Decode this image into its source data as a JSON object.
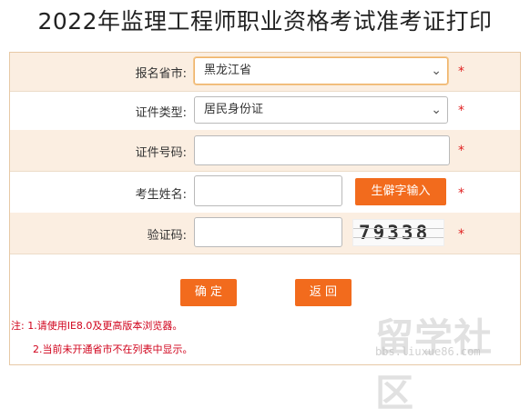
{
  "page": {
    "title": "2022年监理工程师职业资格考试准考证打印"
  },
  "form": {
    "province": {
      "label": "报名省市:",
      "value": "黑龙江省"
    },
    "id_type": {
      "label": "证件类型:",
      "value": "居民身份证"
    },
    "id_number": {
      "label": "证件号码:",
      "value": ""
    },
    "name": {
      "label": "考生姓名:",
      "value": "",
      "rare_char_button": "生僻字输入"
    },
    "captcha": {
      "label": "验证码:",
      "value": "",
      "code": "79338"
    },
    "required_mark": "*",
    "confirm_button": "确 定",
    "back_button": "返 回"
  },
  "notes": {
    "line1": "注: 1.请使用IE8.0及更高版本浏览器。",
    "line2": "2.当前未开通省市不在列表中显示。"
  },
  "watermark": {
    "text": "留学社区",
    "url": "bbs.liuxue86.com"
  },
  "colors": {
    "accent": "#f26b1d",
    "row_alt": "#fbeee1",
    "required": "#e02020",
    "note": "#d0021b"
  }
}
